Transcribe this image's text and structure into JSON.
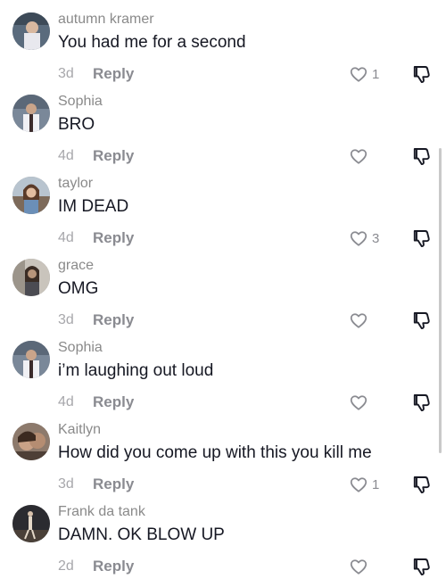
{
  "comments": [
    {
      "username": "autumn kramer",
      "text": "You had me for a second",
      "age": "3d",
      "reply": "Reply",
      "likes": "1"
    },
    {
      "username": "Sophia",
      "text": "BRO",
      "age": "4d",
      "reply": "Reply",
      "likes": ""
    },
    {
      "username": "taylor",
      "text": "IM DEAD",
      "age": "4d",
      "reply": "Reply",
      "likes": "3"
    },
    {
      "username": "grace",
      "text": "OMG",
      "age": "3d",
      "reply": "Reply",
      "likes": ""
    },
    {
      "username": "Sophia",
      "text": "i’m laughing out loud",
      "age": "4d",
      "reply": "Reply",
      "likes": ""
    },
    {
      "username": "Kaitlyn",
      "text": "How did you come up with this you kill me",
      "age": "3d",
      "reply": "Reply",
      "likes": "1"
    },
    {
      "username": "Frank da tank",
      "text": "DAMN. OK BLOW UP",
      "age": "2d",
      "reply": "Reply",
      "likes": ""
    }
  ],
  "icons": {
    "like": "heart-outline-icon",
    "dislike": "thumbs-down-icon"
  },
  "colors": {
    "username": "#8a8a8a",
    "text": "#161823",
    "meta": "#8a8b91",
    "background": "#ffffff"
  }
}
